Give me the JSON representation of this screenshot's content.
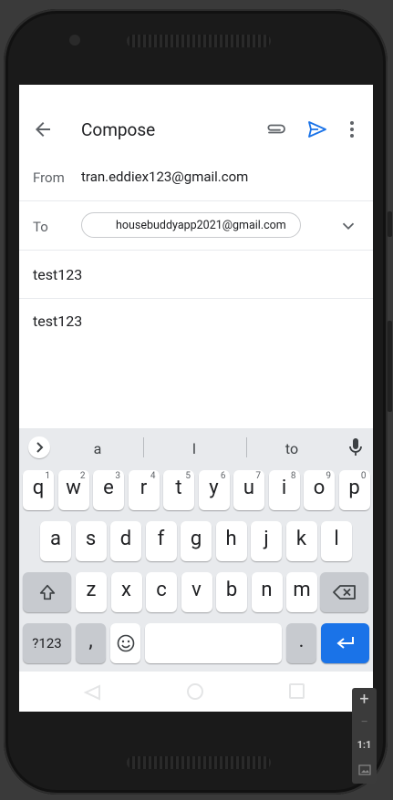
{
  "app_bar": {
    "title": "Compose"
  },
  "from": {
    "label": "From",
    "value": "tran.eddiex123@gmail.com"
  },
  "to": {
    "label": "To",
    "recipient": "housebuddyapp2021@gmail.com"
  },
  "subject": "test123",
  "body": "test123",
  "keyboard": {
    "suggestions": [
      "a",
      "l",
      "to"
    ],
    "row1": [
      {
        "ch": "q",
        "hint": "1"
      },
      {
        "ch": "w",
        "hint": "2"
      },
      {
        "ch": "e",
        "hint": "3"
      },
      {
        "ch": "r",
        "hint": "4"
      },
      {
        "ch": "t",
        "hint": "5"
      },
      {
        "ch": "y",
        "hint": "6"
      },
      {
        "ch": "u",
        "hint": "7"
      },
      {
        "ch": "i",
        "hint": "8"
      },
      {
        "ch": "o",
        "hint": "9"
      },
      {
        "ch": "p",
        "hint": "0"
      }
    ],
    "row2": [
      "a",
      "s",
      "d",
      "f",
      "g",
      "h",
      "j",
      "k",
      "l"
    ],
    "row3": [
      "z",
      "x",
      "c",
      "v",
      "b",
      "n",
      "m"
    ],
    "symbols_label": "?123",
    "comma": ",",
    "period": ".",
    "accent_color": "#1a73e8"
  },
  "zoom_controls": {
    "zoom_in": "+",
    "zoom_out": "−",
    "one_to_one": "1:1"
  },
  "icons": [
    "back-arrow-icon",
    "paperclip-icon",
    "send-icon",
    "more-vert-icon",
    "chevron-down-icon",
    "chevron-right-icon",
    "mic-icon",
    "shift-icon",
    "backspace-icon",
    "emoji-icon",
    "enter-icon",
    "screenshot-icon"
  ]
}
